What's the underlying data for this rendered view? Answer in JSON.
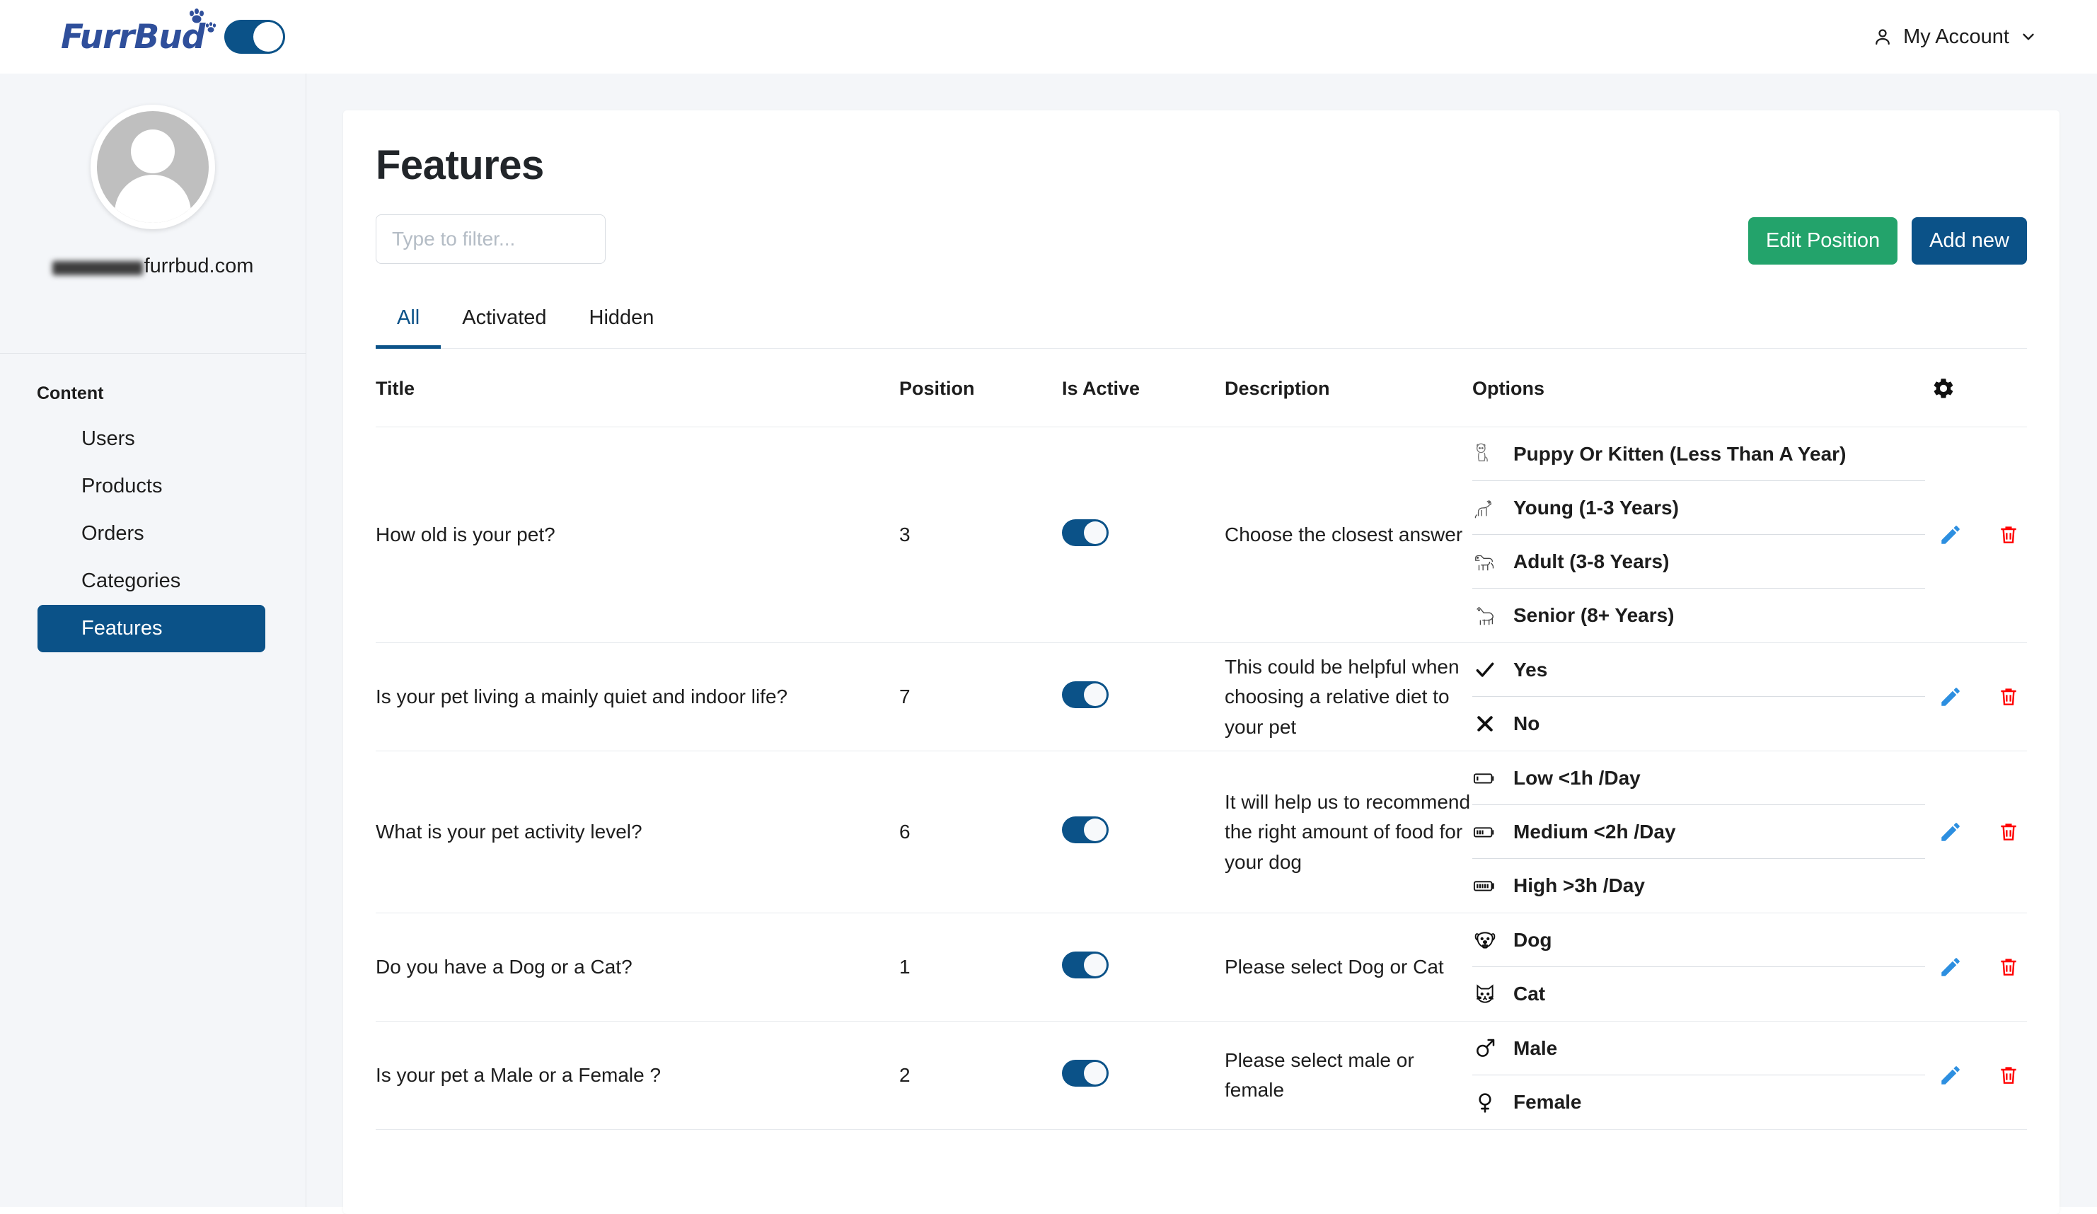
{
  "brand": {
    "name": "FurrBud",
    "logo_icon": "paw-print-icon",
    "sidebar_toggle_icon": "sidebar-toggle"
  },
  "topbar": {
    "account_label": "My Account",
    "account_icon": "user-icon",
    "chevron_icon": "chevron-down-icon"
  },
  "sidebar": {
    "profile": {
      "avatar_icon": "user-avatar-icon",
      "email_visible": "furrbud.com",
      "email_redacted": true
    },
    "section_title": "Content",
    "items": [
      {
        "label": "Users",
        "active": false
      },
      {
        "label": "Products",
        "active": false
      },
      {
        "label": "Orders",
        "active": false
      },
      {
        "label": "Categories",
        "active": false
      },
      {
        "label": "Features",
        "active": true
      }
    ]
  },
  "page": {
    "title": "Features",
    "filter_placeholder": "Type to filter...",
    "filter_value": "",
    "buttons": {
      "edit_position": "Edit Position",
      "add_new": "Add new"
    },
    "colors": {
      "accent_blue": "#0b5288",
      "success_green": "#23a36b",
      "danger_red": "#ff0000",
      "edit_blue": "#2d8fe0"
    },
    "tabs": [
      {
        "label": "All",
        "active": true
      },
      {
        "label": "Activated",
        "active": false
      },
      {
        "label": "Hidden",
        "active": false
      }
    ],
    "table": {
      "settings_icon": "gear-icon",
      "columns": [
        "Title",
        "Position",
        "Is Active",
        "Description",
        "Options",
        ""
      ],
      "rows": [
        {
          "title": "How old is your pet?",
          "position": "3",
          "is_active": true,
          "description": "Choose the closest answer",
          "options": [
            {
              "label": "Puppy Or Kitten (Less Than A Year)",
              "icon": "puppy-icon"
            },
            {
              "label": "Young (1-3 Years)",
              "icon": "young-dog-icon"
            },
            {
              "label": "Adult (3-8 Years)",
              "icon": "adult-dog-icon"
            },
            {
              "label": "Senior (8+ Years)",
              "icon": "senior-dog-icon"
            }
          ],
          "edit_icon": "pencil-icon",
          "delete_icon": "trash-icon"
        },
        {
          "title": "Is your pet living a mainly quiet and indoor life?",
          "position": "7",
          "is_active": true,
          "description": "This could be helpful when choosing a relative diet to your pet",
          "options": [
            {
              "label": "Yes",
              "icon": "check-icon"
            },
            {
              "label": "No",
              "icon": "cross-icon"
            }
          ],
          "edit_icon": "pencil-icon",
          "delete_icon": "trash-icon"
        },
        {
          "title": "What is your pet activity level?",
          "position": "6",
          "is_active": true,
          "description": "It will help us to recommend the right amount of food for your dog",
          "options": [
            {
              "label": "Low <1h /Day",
              "icon": "battery-low-icon"
            },
            {
              "label": "Medium <2h /Day",
              "icon": "battery-medium-icon"
            },
            {
              "label": "High >3h /Day",
              "icon": "battery-full-icon"
            }
          ],
          "edit_icon": "pencil-icon",
          "delete_icon": "trash-icon"
        },
        {
          "title": "Do you have a Dog or a Cat?",
          "position": "1",
          "is_active": true,
          "description": "Please select Dog or Cat",
          "options": [
            {
              "label": "Dog",
              "icon": "dog-face-icon"
            },
            {
              "label": "Cat",
              "icon": "cat-face-icon"
            }
          ],
          "edit_icon": "pencil-icon",
          "delete_icon": "trash-icon"
        },
        {
          "title": "Is your pet a Male or a Female ?",
          "position": "2",
          "is_active": true,
          "description": "Please select male or female",
          "options": [
            {
              "label": "Male",
              "icon": "mars-symbol-icon"
            },
            {
              "label": "Female",
              "icon": "venus-symbol-icon"
            }
          ],
          "edit_icon": "pencil-icon",
          "delete_icon": "trash-icon"
        }
      ]
    }
  }
}
